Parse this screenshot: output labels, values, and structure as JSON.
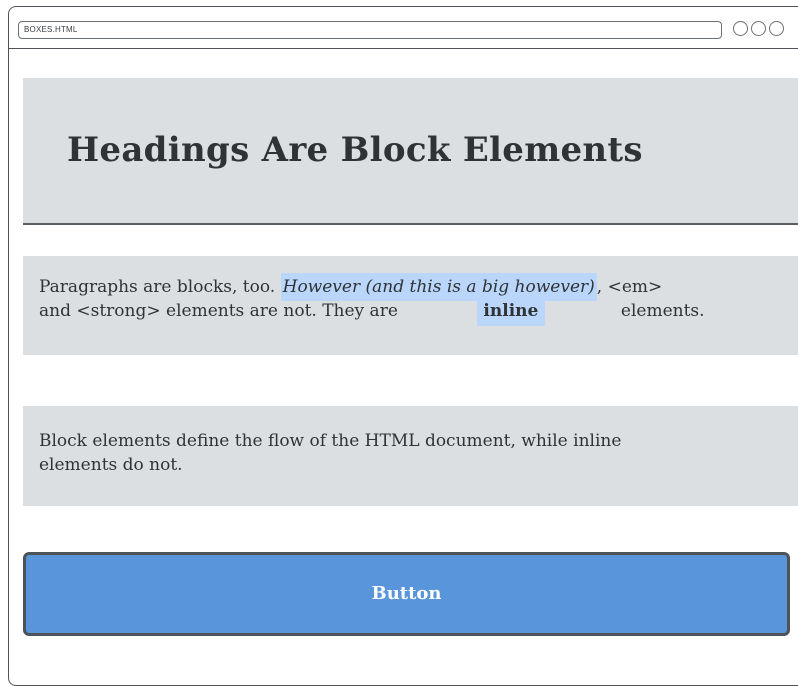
{
  "window": {
    "address": "BOXES.HTML"
  },
  "heading": {
    "text": "Headings Are Block Elements"
  },
  "paragraph1": {
    "text_start": "Paragraphs are blocks, too. ",
    "em_text": "However (and this is a big however)",
    "text_middle": ", <em>",
    "line2_start": "and <strong> elements are not. They are",
    "strong_text": "inline",
    "line2_end": "elements."
  },
  "paragraph2": {
    "line1": "Block elements define the flow of the HTML document, while inline",
    "line2": "elements do not."
  },
  "button": {
    "label": "Button"
  },
  "colors": {
    "box_background": "#dcdfe2",
    "highlight": "#bad6fb",
    "button": "#5995db",
    "border": "#4e5358"
  }
}
